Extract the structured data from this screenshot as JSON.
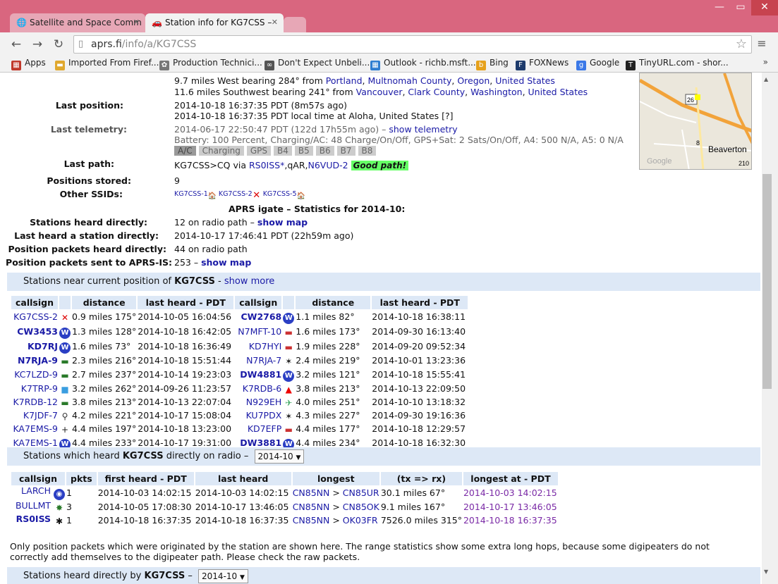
{
  "browser": {
    "tabs": [
      {
        "label": "Satellite and Space Comm",
        "icon": "globe-icon"
      },
      {
        "label": "Station info for KG7CSS –",
        "icon": "car-icon"
      }
    ],
    "url_host": "aprs.fi",
    "url_path": "/info/a/KG7CSS",
    "bookmarks": [
      {
        "label": "Apps",
        "icon": "apps-icon",
        "color": "#c0392b"
      },
      {
        "label": "Imported From Firef...",
        "icon": "folder-icon",
        "color": "#e0a82e"
      },
      {
        "label": "Production Technici...",
        "icon": "gear-icon",
        "color": "#777"
      },
      {
        "label": "Don't Expect Unbeli...",
        "icon": "link-icon",
        "color": "#555"
      },
      {
        "label": "Outlook - richb.msft...",
        "icon": "windows-icon",
        "color": "#2e7dd1"
      },
      {
        "label": "Bing",
        "icon": "bing-icon",
        "color": "#e6a11c"
      },
      {
        "label": "FOXNews",
        "icon": "fox-icon",
        "color": "#1d3a6b"
      },
      {
        "label": "Google",
        "icon": "google-icon",
        "color": "#3b78e7"
      },
      {
        "label": "TinyURL.com - shor...",
        "icon": "tinyurl-icon",
        "color": "#222"
      }
    ],
    "bookmarks_more": "»"
  },
  "info": {
    "loc_line1": "9.7 miles West bearing 284° from",
    "loc_line1_links": [
      "Portland",
      "Multnomah County",
      "Oregon",
      "United States"
    ],
    "loc_line2": "11.6 miles Southwest bearing 241° from",
    "loc_line2_links": [
      "Vancouver",
      "Clark County",
      "Washington",
      "United States"
    ],
    "last_position_label": "Last position:",
    "last_position_1": "2014-10-18 16:37:35 PDT (8m57s ago)",
    "last_position_2": "2014-10-18 16:37:35 PDT local time at Aloha, United States [?]",
    "last_telemetry_label": "Last telemetry:",
    "last_telemetry": "2014-06-17 22:50:47 PDT (122d 17h55m ago) –",
    "show_telemetry": "show telemetry",
    "telemetry_detail": "Battery: 100 Percent, Charging/AC: 48 Charge/On/Off, GPS+Sat: 2 Sats/On/Off, A4: 500 N/A, A5: 0 N/A",
    "telemetry_bits": [
      "A/C",
      "Charging",
      "GPS",
      "B4",
      "B5",
      "B6",
      "B7",
      "B8"
    ],
    "last_path_label": "Last path:",
    "path_prefix": "KG7CSS>CQ via",
    "path_digi": "RS0ISS*",
    "path_mid": ",qAR,",
    "path_igate": "N6VUD-2",
    "good_path": "Good path!",
    "positions_stored_label": "Positions stored:",
    "positions_stored": "9",
    "other_ssids_label": "Other SSIDs:",
    "other_ssids": [
      "KG7CSS-1",
      "KG7CSS-2",
      "KG7CSS-5"
    ],
    "igate_title": "APRS igate – Statistics for 2014-10:",
    "heard_directly_label": "Stations heard directly:",
    "heard_directly": "12 on radio path –",
    "show_map": "show map",
    "last_heard_label": "Last heard a station directly:",
    "last_heard": "2014-10-17 17:46:41 PDT (22h59m ago)",
    "pos_heard_label": "Position packets heard directly:",
    "pos_heard": "44 on radio path",
    "pos_sent_label": "Position packets sent to APRS-IS:",
    "pos_sent": "253 –",
    "map_labels": [
      "26",
      "8",
      "Beaverton",
      "210",
      "Google"
    ]
  },
  "near": {
    "title_prefix": "Stations near current position of",
    "title_call": "KG7CSS",
    "title_sep": "-",
    "show_more": "show more",
    "headers": [
      "callsign",
      "distance",
      "last heard - PDT",
      "callsign",
      "distance",
      "last heard - PDT"
    ],
    "left": [
      {
        "call": "KG7CSS-2",
        "bold": false,
        "icon": "cross-icon",
        "dist": "0.9 miles 175°",
        "time": "2014-10-05 16:04:56"
      },
      {
        "call": "CW3453",
        "bold": true,
        "icon": "weather-station-icon",
        "dist": "1.3 miles 128°",
        "time": "2014-10-18 16:42:05"
      },
      {
        "call": "KD7RJ",
        "bold": true,
        "icon": "weather-station-icon",
        "dist": "1.6 miles 73°",
        "time": "2014-10-18 16:36:49"
      },
      {
        "call": "N7RJA-9",
        "bold": true,
        "icon": "truck-icon",
        "dist": "2.3 miles 216°",
        "time": "2014-10-18 15:51:44"
      },
      {
        "call": "KC7LZD-9",
        "bold": false,
        "icon": "truck-icon",
        "dist": "2.7 miles 237°",
        "time": "2014-10-14 19:23:03"
      },
      {
        "call": "K7TRP-9",
        "bold": false,
        "icon": "van-icon",
        "dist": "3.2 miles 262°",
        "time": "2014-09-26 11:23:57"
      },
      {
        "call": "K7RDB-12",
        "bold": false,
        "icon": "truck-icon",
        "dist": "3.8 miles 213°",
        "time": "2014-10-13 22:07:04"
      },
      {
        "call": "K7JDF-7",
        "bold": false,
        "icon": "motorcycle-icon",
        "dist": "4.2 miles 221°",
        "time": "2014-10-17 15:08:04"
      },
      {
        "call": "KA7EMS-9",
        "bold": false,
        "icon": "plus-icon",
        "dist": "4.4 miles 197°",
        "time": "2014-10-18 13:23:00"
      },
      {
        "call": "KA7EMS-1",
        "bold": false,
        "icon": "weather-station-icon",
        "dist": "4.4 miles 233°",
        "time": "2014-10-17 19:31:00"
      }
    ],
    "right": [
      {
        "call": "CW2768",
        "bold": true,
        "icon": "weather-station-icon",
        "dist": "1.1 miles 82°",
        "time": "2014-10-18 16:38:11"
      },
      {
        "call": "N7MFT-10",
        "bold": false,
        "icon": "car-icon",
        "dist": "1.6 miles 173°",
        "time": "2014-09-30 16:13:40"
      },
      {
        "call": "KD7HYI",
        "bold": false,
        "icon": "car-icon",
        "dist": "1.9 miles 228°",
        "time": "2014-09-20 09:52:34"
      },
      {
        "call": "N7RJA-7",
        "bold": false,
        "icon": "runner-icon",
        "dist": "2.4 miles 219°",
        "time": "2014-10-01 13:23:36"
      },
      {
        "call": "DW4881",
        "bold": true,
        "icon": "weather-station-icon",
        "dist": "3.2 miles 121°",
        "time": "2014-10-18 15:55:41"
      },
      {
        "call": "K7RDB-6",
        "bold": false,
        "icon": "triangle-icon",
        "dist": "3.8 miles 213°",
        "time": "2014-10-13 22:09:50"
      },
      {
        "call": "N929EH",
        "bold": false,
        "icon": "airplane-icon",
        "dist": "4.0 miles 251°",
        "time": "2014-10-10 13:18:32"
      },
      {
        "call": "KU7PDX",
        "bold": false,
        "icon": "runner-icon",
        "dist": "4.3 miles 227°",
        "time": "2014-09-30 19:16:36"
      },
      {
        "call": "KD7EFP",
        "bold": false,
        "icon": "car-icon",
        "dist": "4.4 miles 177°",
        "time": "2014-10-18 12:29:57"
      },
      {
        "call": "DW3881",
        "bold": true,
        "icon": "weather-station-icon",
        "dist": "4.4 miles 234°",
        "time": "2014-10-18 16:32:30"
      }
    ]
  },
  "heard_by": {
    "title_prefix": "Stations which heard",
    "title_call": "KG7CSS",
    "title_suffix": "directly on radio –",
    "month": "2014-10",
    "headers": [
      "callsign",
      "pkts",
      "first heard - PDT",
      "last heard",
      "longest",
      "(tx => rx)",
      "longest at - PDT"
    ],
    "rows": [
      {
        "call": "LARCH",
        "bold": false,
        "icon": "digi-icon",
        "pkts": "1",
        "first": "2014-10-03 14:02:15",
        "last": "2014-10-03 14:02:15",
        "from": "CN85NN",
        "to": "CN85UR",
        "dist": "30.1 miles 67°",
        "at": "2014-10-03 14:02:15"
      },
      {
        "call": "BULLMT",
        "bold": false,
        "icon": "star-icon",
        "pkts": "3",
        "first": "2014-10-05 17:08:30",
        "last": "2014-10-17 13:46:05",
        "from": "CN85NN",
        "to": "CN85OK",
        "dist": "9.1 miles 167°",
        "at": "2014-10-17 13:46:05"
      },
      {
        "call": "RS0ISS",
        "bold": true,
        "icon": "satellite-icon",
        "pkts": "1",
        "first": "2014-10-18 16:37:35",
        "last": "2014-10-18 16:37:35",
        "from": "CN85NN",
        "to": "OK03FR",
        "dist": "7526.0 miles 315°",
        "at": "2014-10-18 16:37:35"
      }
    ],
    "gt": ">"
  },
  "note": "Only position packets which were originated by the station are shown here. The range statistics show some extra long hops, because some digipeaters do not correctly add themselves to the digipeater path. Please check the raw packets.",
  "heard_dir": {
    "title_prefix": "Stations heard directly by",
    "title_call": "KG7CSS",
    "title_suffix": "–",
    "month": "2014-10"
  }
}
